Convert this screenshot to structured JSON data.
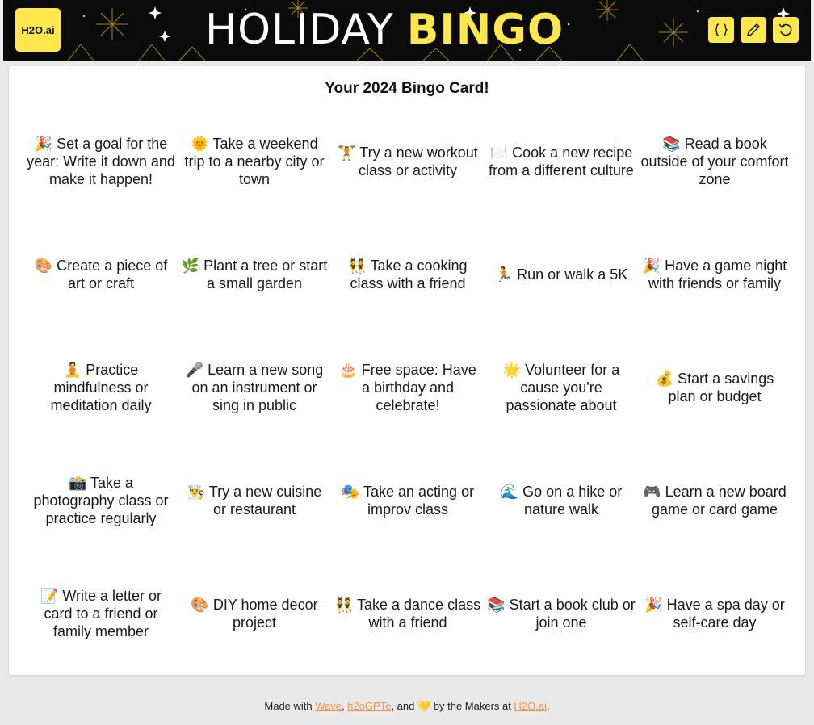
{
  "header": {
    "logo_text": "H2O.ai",
    "title_part1": "HOLIDAY",
    "title_part2": "BINGO",
    "buttons": [
      {
        "name": "code-button",
        "icon": "braces-icon"
      },
      {
        "name": "edit-button",
        "icon": "pencil-icon"
      },
      {
        "name": "reset-button",
        "icon": "undo-icon"
      }
    ],
    "colors": {
      "background": "#0b0b0b",
      "accent": "#fde74c"
    }
  },
  "card": {
    "title": "Your 2024 Bingo Card!",
    "cells": [
      "🎉 Set a goal for the year: Write it down and make it happen!",
      "🌞 Take a weekend trip to a nearby city or town",
      "🏋️ Try a new workout class or activity",
      "🍽️ Cook a new recipe from a different culture",
      "📚 Read a book outside of your comfort zone",
      "🎨 Create a piece of art or craft",
      "🌿 Plant a tree or start a small garden",
      "👯 Take a cooking class with a friend",
      "🏃 Run or walk a 5K",
      "🎉 Have a game night with friends or family",
      "🧘 Practice mindfulness or meditation daily",
      "🎤 Learn a new song on an instrument or sing in public",
      "🎂 Free space: Have a birthday and celebrate!",
      "🌟 Volunteer for a cause you're passionate about",
      "💰 Start a savings plan or budget",
      "📸 Take a photography class or practice regularly",
      "👨‍🍳 Try a new cuisine or restaurant",
      "🎭 Take an acting or improv class",
      "🌊 Go on a hike or nature walk",
      "🎮 Learn a new board game or card game",
      "📝 Write a letter or card to a friend or family member",
      "🎨 DIY home decor project",
      "👯 Take a dance class with a friend",
      "📚 Start a book club or join one",
      "🎉 Have a spa day or self-care day"
    ]
  },
  "footer": {
    "prefix": "Made with ",
    "link1": "Wave",
    "sep1": ", ",
    "link2": "h2oGPTe",
    "middle": ", and 💛 by the Makers at ",
    "link3": "H2O.ai",
    "suffix": ".",
    "link_color": "#f5923e"
  }
}
